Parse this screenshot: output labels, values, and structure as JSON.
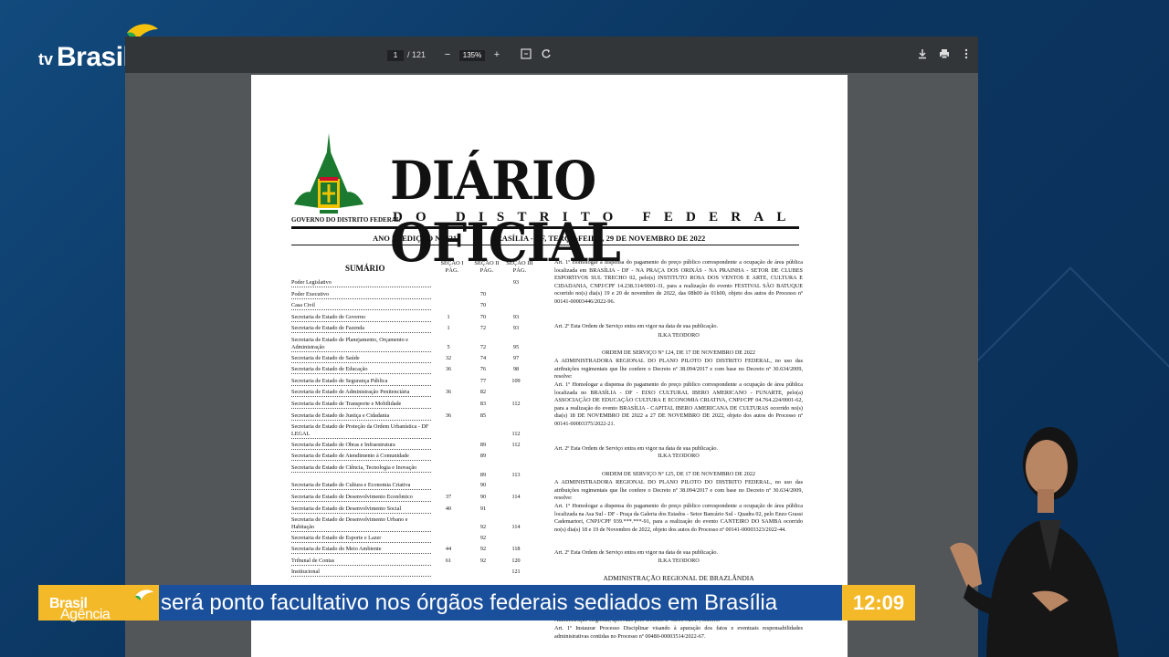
{
  "channel": {
    "tv": "tv",
    "brand": "Brasil"
  },
  "viewer": {
    "page_current": "1",
    "page_total": "/ 121",
    "zoom_out": "−",
    "zoom": "135%",
    "zoom_in": "+",
    "icons": [
      "fit-page-icon",
      "rotate-icon",
      "download-icon",
      "print-icon",
      "more-vert-icon"
    ]
  },
  "document": {
    "gov_label": "GOVERNO DO DISTRITO FEDERAL",
    "title": "DIÁRIO OFICIAL",
    "subtitle": "DO DISTRITO FEDERAL",
    "edition": "ANO LI EDIÇÃO Nº 221",
    "dateline": "BRASÍLIA - DF, TERÇA-FEIRA, 29 DE NOVEMBRO DE 2022",
    "summary": {
      "title": "SUMÁRIO",
      "col1": "SEÇÃO I PÁG.",
      "col2": "SEÇÃO II PÁG.",
      "col3": "SEÇÃO III PÁG.",
      "rows": [
        {
          "name": "Poder Legislativo",
          "s1": "",
          "s2": "",
          "s3": "93"
        },
        {
          "name": "Poder Executivo",
          "s1": "",
          "s2": "70",
          "s3": ""
        },
        {
          "name": "Casa Civil",
          "s1": "",
          "s2": "70",
          "s3": ""
        },
        {
          "name": "Secretaria de Estado de Governo",
          "s1": "1",
          "s2": "70",
          "s3": "93"
        },
        {
          "name": "Secretaria de Estado de Fazenda",
          "s1": "1",
          "s2": "72",
          "s3": "93"
        },
        {
          "name": "Secretaria de Estado de Planejamento, Orçamento e Administração",
          "s1": "5",
          "s2": "72",
          "s3": "95"
        },
        {
          "name": "Secretaria de Estado de Saúde",
          "s1": "32",
          "s2": "74",
          "s3": "97"
        },
        {
          "name": "Secretaria de Estado de Educação",
          "s1": "36",
          "s2": "76",
          "s3": "98"
        },
        {
          "name": "Secretaria de Estado de Segurança Pública",
          "s1": "",
          "s2": "77",
          "s3": "109"
        },
        {
          "name": "Secretaria de Estado de Administração Penitenciária",
          "s1": "36",
          "s2": "82",
          "s3": ""
        },
        {
          "name": "Secretaria de Estado de Transporte e Mobilidade",
          "s1": "",
          "s2": "83",
          "s3": "112"
        },
        {
          "name": "Secretaria de Estado de Justiça e Cidadania",
          "s1": "36",
          "s2": "85",
          "s3": ""
        },
        {
          "name": "Secretaria de Estado de Proteção da Ordem Urbanística - DF LEGAL",
          "s1": "",
          "s2": "",
          "s3": "112"
        },
        {
          "name": "Secretaria de Estado de Obras e Infraestrutura",
          "s1": "",
          "s2": "89",
          "s3": "112"
        },
        {
          "name": "Secretaria de Estado de Atendimento à Comunidade",
          "s1": "",
          "s2": "89",
          "s3": ""
        },
        {
          "name": "Secretaria de Estado de Ciência, Tecnologia e Inovação",
          "s1": "",
          "s2": "89",
          "s3": "113"
        },
        {
          "name": "Secretaria de Estado de Cultura e Economia Criativa",
          "s1": "",
          "s2": "90",
          "s3": ""
        },
        {
          "name": "Secretaria de Estado de Desenvolvimento Econômico",
          "s1": "37",
          "s2": "90",
          "s3": "114"
        },
        {
          "name": "Secretaria de Estado de Desenvolvimento Social",
          "s1": "40",
          "s2": "91",
          "s3": ""
        },
        {
          "name": "Secretaria de Estado de Desenvolvimento Urbano e Habitação",
          "s1": "",
          "s2": "92",
          "s3": "114"
        },
        {
          "name": "Secretaria de Estado de Esporte e Lazer",
          "s1": "",
          "s2": "92",
          "s3": ""
        },
        {
          "name": "Secretaria de Estado do Meio Ambiente",
          "s1": "44",
          "s2": "92",
          "s3": "118"
        },
        {
          "name": "Tribunal de Contas",
          "s1": "61",
          "s2": "92",
          "s3": "120"
        },
        {
          "name": "Institucional",
          "s1": "",
          "s2": "",
          "s3": "121"
        }
      ]
    },
    "right": {
      "p1": "Art. 1º Homologar a dispensa do pagamento do preço público correspondente a ocupação de área pública localizada em BRASÍLIA - DF - NA PRAÇA DOS ORIXÁS - NA PRAINHA - SETOR DE CLUBES ESPORTIVOS SUL TRECHO 02, pelo(s) INSTITUTO ROSA DOS VENTOS E ARTE, CULTURA E CIDADANIA, CNPJ/CPF 14.238.314/0001-31, para a realização do evento FESTIVAL SÃO BATUQUE ocorrido no(s) dia(s) 19 e 20 de novembro de 2022, das 08h00 às 01h00, objeto dos autos do Processo nº 00141-00003446/2022-96.",
      "p2": "Art. 2º Esta Ordem de Serviço entra em vigor na data de sua publicação.",
      "sig1": "ILKA TEODORO",
      "os124": "ORDEM DE SERVIÇO Nº 124, DE 17 DE NOVEMBRO DE 2022",
      "p3": "A ADMINISTRADORA REGIONAL DO PLANO PILOTO DO DISTRITO FEDERAL, no uso das atribuições regimentais que lhe confere o Decreto nº 38.094/2017 e com base no Decreto nº 30.634/2009, resolve:",
      "p4": "Art. 1º Homologar a dispensa do pagamento do preço público correspondente a ocupação de área pública localizada no BRASÍLIA - DF - EIXO CULTURAL IBERO AMERICANO - FUNARTE, pelo(a) ASSOCIAÇÃO DE EDUCAÇÃO CULTURA E ECONOMIA CRIATIVA, CNPJ/CPF 04.764.224/0001-62, para a realização do evento BRASÍLIA - CAPITAL IBERO AMERICANA DE CULTURAS ocorrido no(s) dia(s) 18 DE NOVEMBRO DE 2022 a 27 DE NOVEMBRO DE 2022, objeto dos autos do Processo nº 00141-00003375/2022-21.",
      "p5": "Art. 2º Esta Ordem de Serviço entra em vigor na data de sua publicação.",
      "sig2": "ILKA TEODORO",
      "os125": "ORDEM DE SERVIÇO Nº 125, DE 17 DE NOVEMBRO DE 2022",
      "p6": "A ADMINISTRADORA REGIONAL DO PLANO PILOTO DO DISTRITO FEDERAL, no uso das atribuições regimentais que lhe confere o Decreto nº 38.094/2017 e com base no Decreto nº 30.634/2009, resolve:",
      "p7": "Art. 1º Homologar a dispensa do pagamento do preço público correspondente a ocupação de área pública localizada na Asa Sul - DF - Praça da Galeria dos Estados - Setor Bancário Sul - Quadra 02, pelo Enzo Grassi Cademartori, CNPJ/CPF 939.***.***-91, para a realização do evento CANTEIRO DO SAMBA ocorrido no(s) dia(s) 18 e 19 de Novembro de 2022, objeto dos autos do Processo nº 00141-00003323/2022-44.",
      "p8": "Art. 2º Esta Ordem de Serviço entra em vigor na data de sua publicação.",
      "sig3": "ILKA TEODORO",
      "admin": "ADMINISTRAÇÃO REGIONAL DE BRAZLÂNDIA",
      "p9": "Administração Regional, aprovado pelo Decreto nº 38.094/2017, resolve:",
      "p10": "Art. 1º Instaurar Processo Disciplinar visando à apuração dos fatos e eventuais responsabilidades administrativas contidas no Processo nº 00480-00003514/2022-67."
    }
  },
  "ticker": {
    "brand_a": "Agência",
    "brand_b": "Brasil",
    "headline": "será ponto facultativo nos órgãos federais sediados em Brasília",
    "time": "12:09"
  }
}
